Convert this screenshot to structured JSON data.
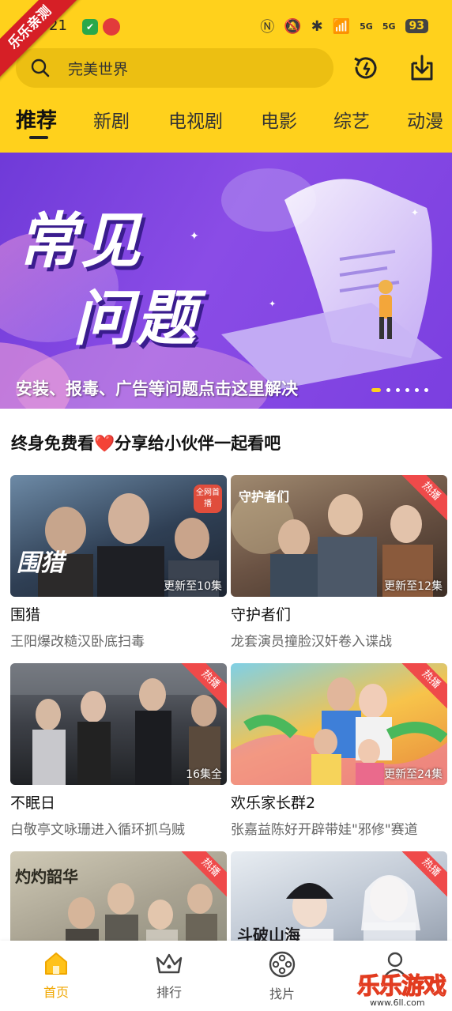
{
  "status_bar": {
    "time": "21",
    "battery": "93",
    "network_1": "5G",
    "network_2": "5G"
  },
  "corner_ribbon": "乐乐亲测",
  "search": {
    "placeholder": "完美世界"
  },
  "header_icons": [
    "history-icon",
    "download-icon"
  ],
  "tabs": [
    {
      "label": "推荐",
      "active": true
    },
    {
      "label": "新剧"
    },
    {
      "label": "电视剧"
    },
    {
      "label": "电影"
    },
    {
      "label": "综艺"
    },
    {
      "label": "动漫"
    }
  ],
  "banner": {
    "title_line1": "常见",
    "title_line2": "问题",
    "caption": "安装、报毒、广告等问题点击这里解决",
    "page_count": 6,
    "current_page": 1
  },
  "section": {
    "title": "终身免费看❤️分享给小伙伴一起看吧"
  },
  "cards": [
    {
      "title": "围猎",
      "desc": "王阳爆改糙汉卧底扫毒",
      "episode": "更新至10集",
      "badge": "全网首播",
      "poster_title": "围猎",
      "accent": "#3a5470"
    },
    {
      "title": "守护者们",
      "desc": "龙套演员撞脸汉奸卷入谍战",
      "episode": "更新至12集",
      "hot": "热播",
      "poster_title": "守护者们",
      "accent": "#6b5344"
    },
    {
      "title": "不眠日",
      "desc": "白敬亭文咏珊进入循环抓乌贼",
      "episode": "16集全",
      "hot": "热播",
      "accent": "#3d4047"
    },
    {
      "title": "欢乐家长群2",
      "desc": "张嘉益陈好开辟带娃\"邪修\"赛道",
      "episode": "更新至24集",
      "hot": "热播",
      "accent": "#e7893c"
    },
    {
      "title": "",
      "desc": "",
      "episode": "",
      "hot": "热播",
      "poster_title": "灼灼韶华",
      "accent": "#8a8a7a"
    },
    {
      "title": "",
      "desc": "",
      "episode": "",
      "hot": "热播",
      "poster_title": "斗破山海",
      "accent": "#b9c2cf"
    }
  ],
  "bottom_nav": [
    {
      "label": "首页",
      "icon": "home-icon",
      "active": true
    },
    {
      "label": "排行",
      "icon": "crown-icon"
    },
    {
      "label": "找片",
      "icon": "film-reel-icon"
    },
    {
      "label": "",
      "icon": "profile-icon"
    }
  ],
  "watermark": {
    "text": "乐乐游戏",
    "sub": "www.6ll.com"
  },
  "colors": {
    "accent_yellow": "#ffd11c",
    "hot_red": "#ef4a4a",
    "banner_purple": "#7b3fe0"
  }
}
